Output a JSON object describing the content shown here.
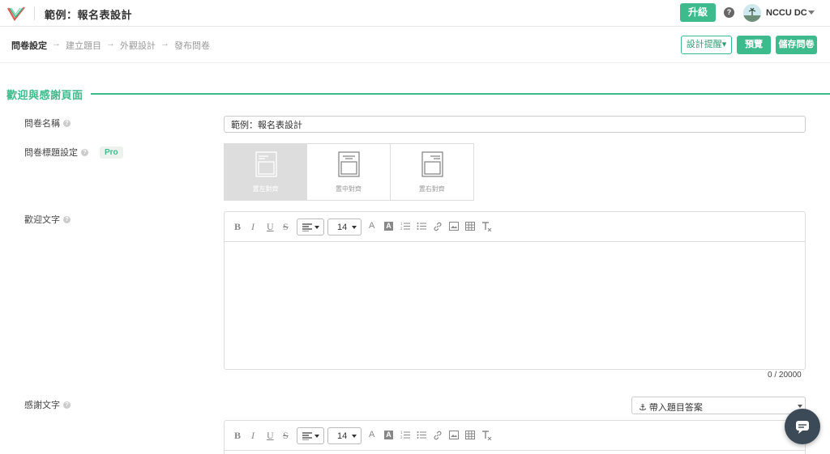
{
  "header": {
    "app_title": "範例：報名表設計",
    "upgrade_label": "升級",
    "help_icon": "help-circle-icon",
    "user_name": "NCCU DC"
  },
  "steps": {
    "items": [
      "問卷設定",
      "建立題目",
      "外觀設計",
      "發布問卷"
    ],
    "active_index": 0,
    "arrow": "→"
  },
  "actions": {
    "hint_label": "設計提醒▾",
    "preview_label": "預覽",
    "save_label": "儲存問卷"
  },
  "section": {
    "title": "歡迎與感謝頁面"
  },
  "form": {
    "name_label": "問卷名稱",
    "name_value": "範例：報名表設計",
    "title_setting_label": "問卷標題設定",
    "pro_badge": "Pro",
    "align_options": [
      "置左對齊",
      "置中對齊",
      "置右對齊"
    ],
    "align_selected": 0,
    "welcome_label": "歡迎文字",
    "thanks_label": "感謝文字",
    "counter": "0 / 20000",
    "answer_select": "⚓ 帶入題目答案"
  },
  "editor": {
    "font_size": "14",
    "tools": [
      "B",
      "I",
      "U",
      "S"
    ]
  },
  "colors": {
    "accent": "#3dbb8c",
    "chat": "#3b4a56"
  }
}
